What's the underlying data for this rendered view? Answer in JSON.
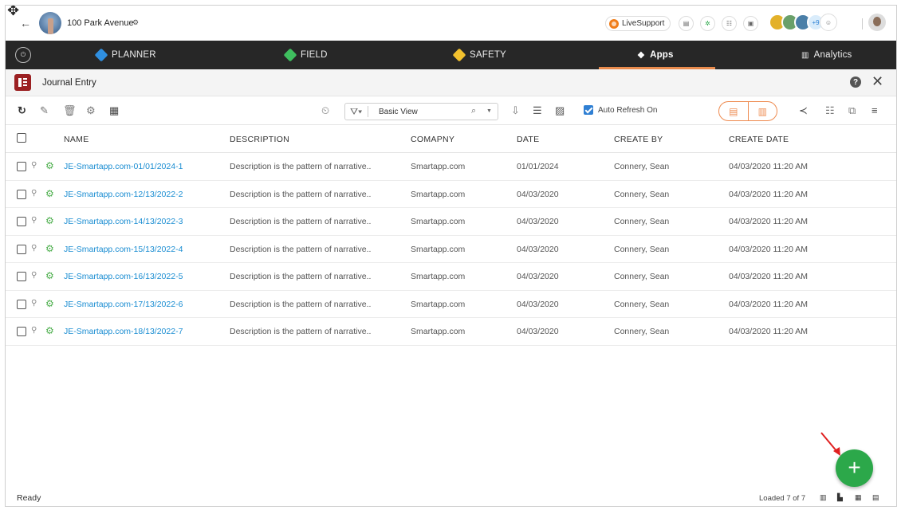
{
  "header": {
    "project_name": "100 Park Avenue",
    "live_support_label": "LiveSupport",
    "extra_people_count": "+9"
  },
  "nav": {
    "items": [
      {
        "label": "PLANNER",
        "icon": "planner-icon",
        "color": "#2f8fe0"
      },
      {
        "label": "FIELD",
        "icon": "field-icon",
        "color": "#3fbf5f"
      },
      {
        "label": "SAFETY",
        "icon": "safety-icon",
        "color": "#f2c12e"
      },
      {
        "label": "Apps",
        "icon": "apps-icon",
        "color": "#ffffff"
      },
      {
        "label": "Analytics",
        "icon": "analytics-icon",
        "color": "#ffffff"
      }
    ],
    "active": "Apps",
    "accent": "#e88b4d"
  },
  "module": {
    "title": "Journal Entry",
    "icon_color": "#9b2022"
  },
  "toolbar": {
    "view_name": "Basic View",
    "auto_refresh_label": "Auto Refresh On",
    "auto_refresh_checked": true
  },
  "table": {
    "columns": [
      "NAME",
      "DESCRIPTION",
      "COMAPNY",
      "DATE",
      "CREATE BY",
      "CREATE DATE"
    ],
    "rows": [
      {
        "name": "JE-Smartapp.com-01/01/2024-1",
        "description": "Description is the pattern of narrative..",
        "company": "Smartapp.com",
        "date": "01/01/2024",
        "created_by": "Connery, Sean",
        "create_date": "04/03/2020 11:20 AM"
      },
      {
        "name": "JE-Smartapp.com-12/13/2022-2",
        "description": "Description is the pattern of narrative..",
        "company": "Smartapp.com",
        "date": "04/03/2020",
        "created_by": "Connery, Sean",
        "create_date": "04/03/2020 11:20 AM"
      },
      {
        "name": "JE-Smartapp.com-14/13/2022-3",
        "description": "Description is the pattern of narrative..",
        "company": "Smartapp.com",
        "date": "04/03/2020",
        "created_by": "Connery, Sean",
        "create_date": "04/03/2020 11:20 AM"
      },
      {
        "name": "JE-Smartapp.com-15/13/2022-4",
        "description": "Description is the pattern of narrative..",
        "company": "Smartapp.com",
        "date": "04/03/2020",
        "created_by": "Connery, Sean",
        "create_date": "04/03/2020 11:20 AM"
      },
      {
        "name": "JE-Smartapp.com-16/13/2022-5",
        "description": "Description is the pattern of narrative..",
        "company": "Smartapp.com",
        "date": "04/03/2020",
        "created_by": "Connery, Sean",
        "create_date": "04/03/2020 11:20 AM"
      },
      {
        "name": "JE-Smartapp.com-17/13/2022-6",
        "description": "Description is the pattern of narrative..",
        "company": "Smartapp.com",
        "date": "04/03/2020",
        "created_by": "Connery, Sean",
        "create_date": "04/03/2020 11:20 AM"
      },
      {
        "name": "JE-Smartapp.com-18/13/2022-7",
        "description": "Description is the pattern of narrative..",
        "company": "Smartapp.com",
        "date": "04/03/2020",
        "created_by": "Connery, Sean",
        "create_date": "04/03/2020 11:20 AM"
      }
    ]
  },
  "footer": {
    "status": "Ready",
    "loaded": "Loaded 7 of 7"
  },
  "fab": {
    "label": "+",
    "color": "#2ca84a"
  }
}
